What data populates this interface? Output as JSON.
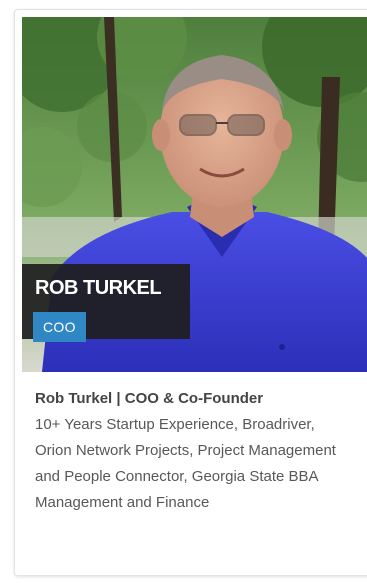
{
  "profile": {
    "name_tag": "ROB TURKEL",
    "role_badge": "COO",
    "headline": "Rob Turkel | COO & Co-Founder",
    "description": "10+ Years Startup Experience, Broadriver, Orion Network Projects, Project Management and People Connector, Georgia State BBA Management and Finance",
    "photo_icon": "person-photo"
  },
  "colors": {
    "badge": "#2f87c4",
    "name_tag_bg": "#1e1e20",
    "shirt": "#3a3ed6"
  }
}
